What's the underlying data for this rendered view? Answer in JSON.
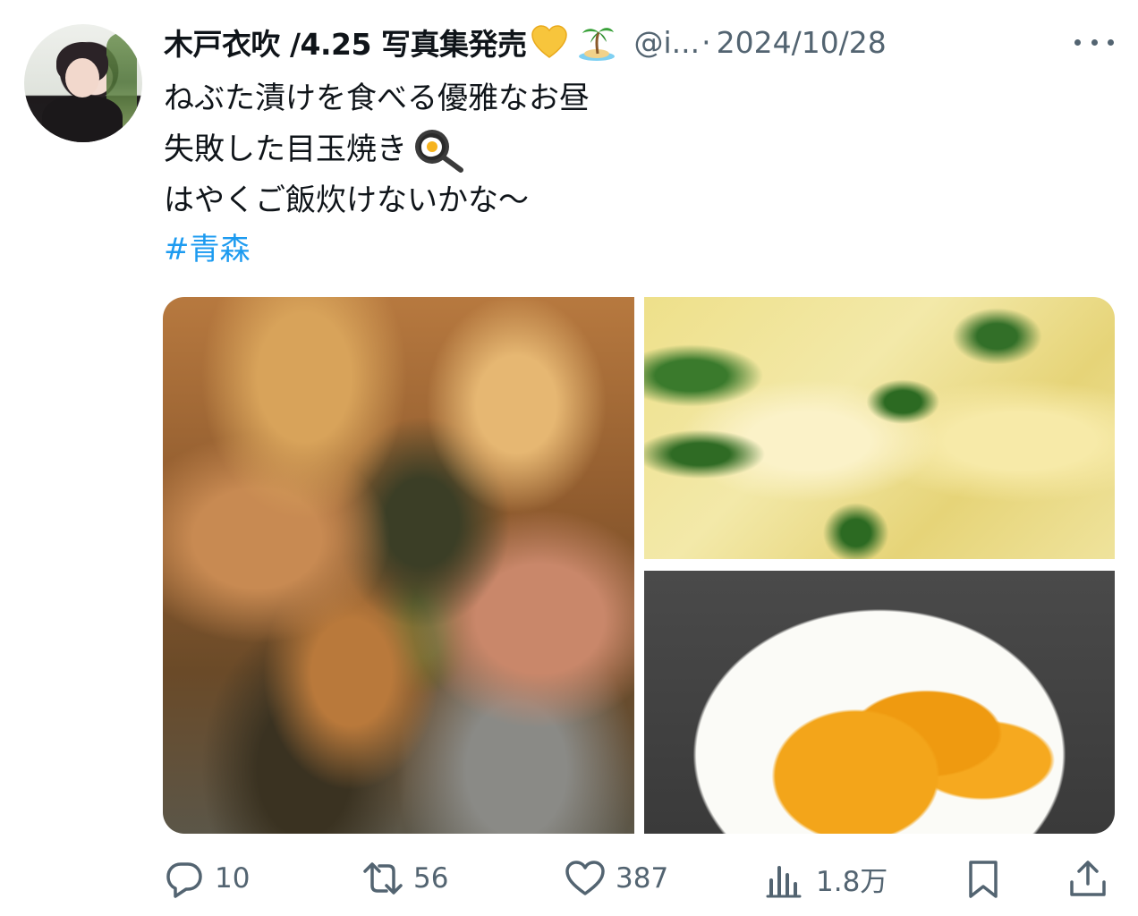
{
  "tweet": {
    "author_name": "木戸衣吹 /4.25 写真集発売",
    "handle": "@i...",
    "separator": "·",
    "date": "2024/10/28",
    "lines": [
      "ねぶた漬けを食べる優雅なお昼",
      "失敗した目玉焼き",
      "はやくご飯炊けないかな〜"
    ],
    "hashtag": "#青森"
  },
  "emojis": {
    "after_name": [
      "yellow-heart-icon",
      "desert-island-icon"
    ],
    "after_line_2": "cooking-egg-pan-icon"
  },
  "actions": {
    "replies": "10",
    "retweets": "56",
    "likes": "387",
    "views": "1.8万"
  },
  "colors": {
    "text": "#0f1419",
    "secondary": "#536471",
    "link": "#1d9bf0"
  }
}
